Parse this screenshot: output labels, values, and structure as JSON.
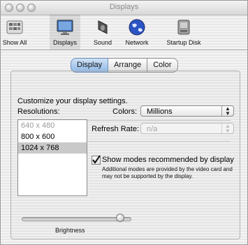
{
  "window": {
    "title": "Displays"
  },
  "toolbar": {
    "items": [
      {
        "label": "Show All",
        "icon": "show-all-icon",
        "active": false
      },
      {
        "label": "Displays",
        "icon": "display-icon",
        "active": true
      },
      {
        "label": "Sound",
        "icon": "speaker-icon",
        "active": false
      },
      {
        "label": "Network",
        "icon": "globe-icon",
        "active": false
      },
      {
        "label": "Startup Disk",
        "icon": "disk-icon",
        "active": false
      }
    ]
  },
  "tabs": [
    {
      "label": "Display",
      "active": true
    },
    {
      "label": "Arrange",
      "active": false
    },
    {
      "label": "Color",
      "active": false
    }
  ],
  "panel": {
    "heading": "Customize your display settings.",
    "resolutions_label": "Resolutions:",
    "resolutions": [
      {
        "label": "640 x 480",
        "state": "disabled"
      },
      {
        "label": "800 x 600",
        "state": "normal"
      },
      {
        "label": "1024 x 768",
        "state": "selected"
      }
    ],
    "colors": {
      "label": "Colors:",
      "value": "Millions"
    },
    "refresh_rate": {
      "label": "Refresh Rate:",
      "value": "n/a",
      "disabled": true
    },
    "recommended": {
      "label": "Show modes recommended by display",
      "checked": true,
      "note": "Additional modes are provided by the video card and may not be supported by the display."
    },
    "brightness": {
      "label": "Brightness",
      "value_fraction": 0.9
    }
  },
  "colors": {
    "accent": "#8fb8e7",
    "selection": "#c9c9c9"
  }
}
